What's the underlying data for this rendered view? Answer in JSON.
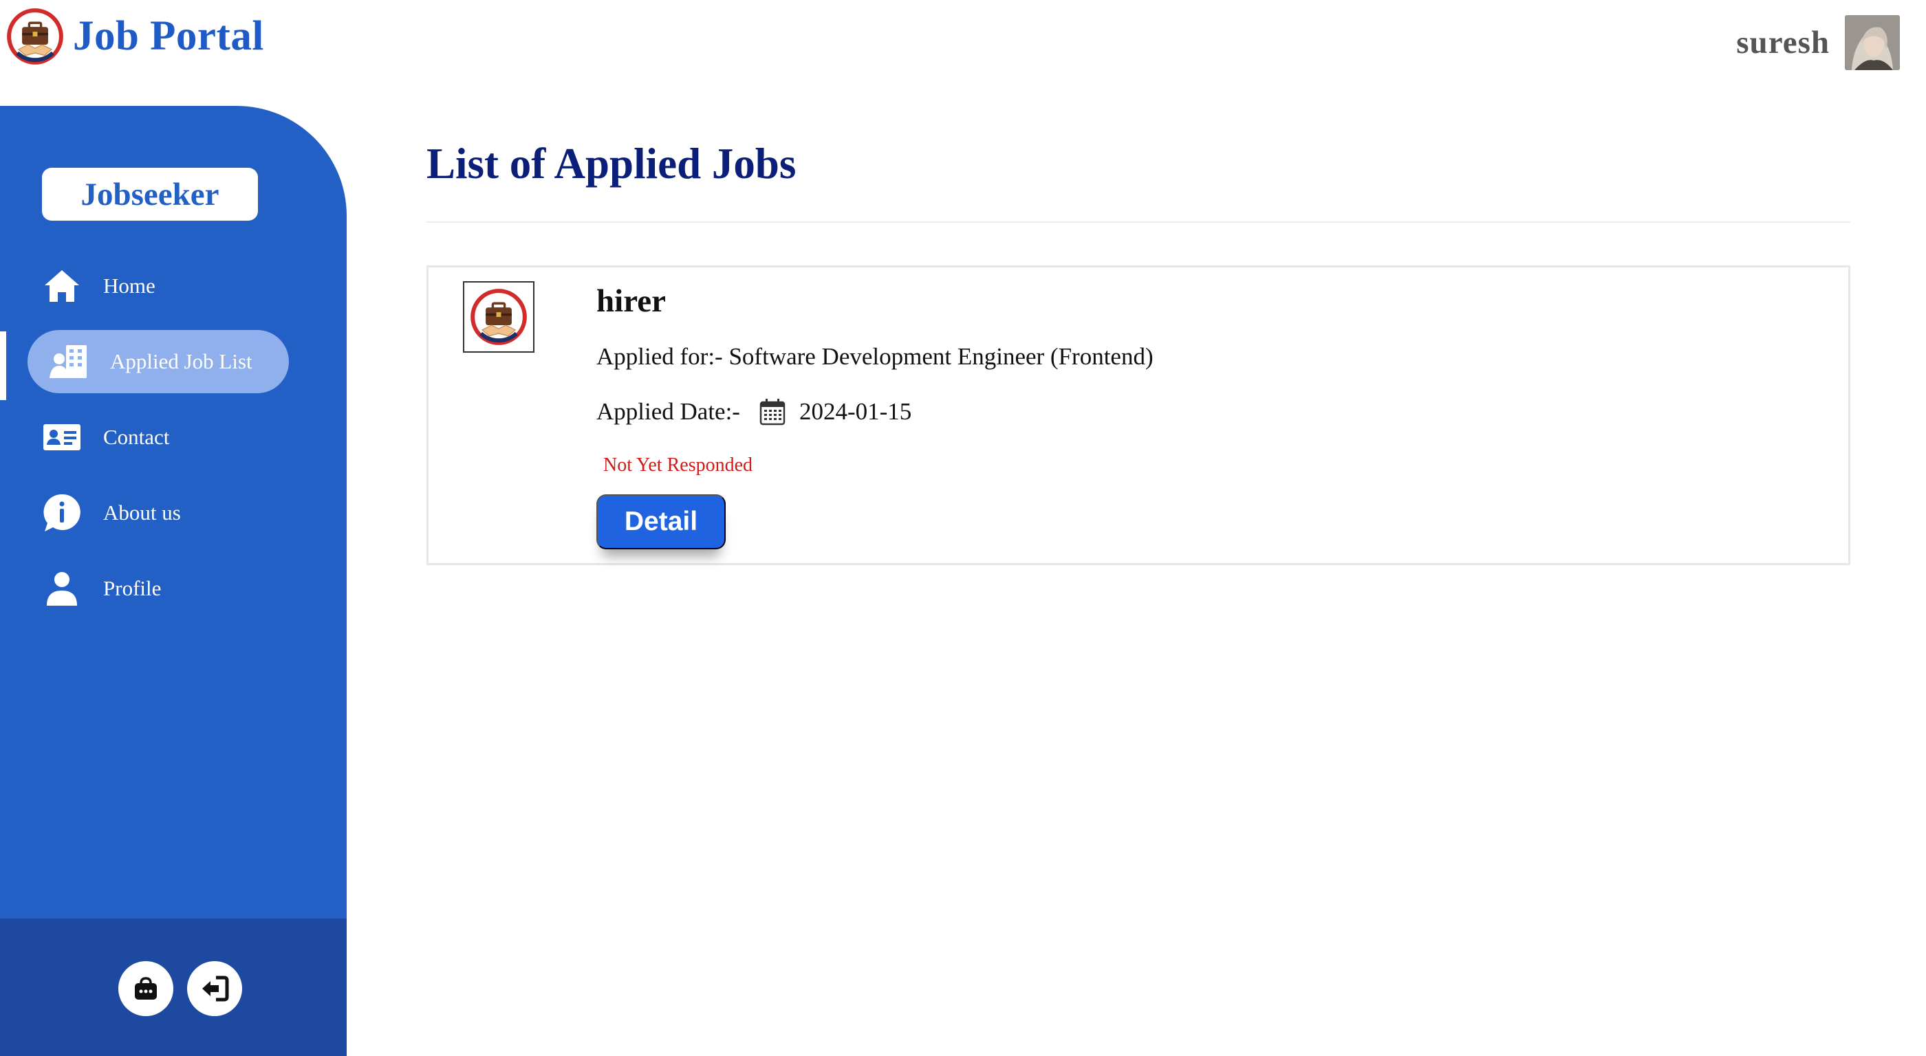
{
  "header": {
    "brand_title": "Job Portal",
    "user_name": "suresh"
  },
  "sidebar": {
    "role_label": "Jobseeker",
    "items": [
      {
        "label": "Home",
        "icon": "home-icon",
        "active": false
      },
      {
        "label": "Applied Job List",
        "icon": "applied-list-icon",
        "active": true
      },
      {
        "label": "Contact",
        "icon": "contact-card-icon",
        "active": false
      },
      {
        "label": "About us",
        "icon": "info-icon",
        "active": false
      },
      {
        "label": "Profile",
        "icon": "user-icon",
        "active": false
      }
    ],
    "footer_buttons": [
      {
        "icon": "jobs-bag-icon"
      },
      {
        "icon": "logout-icon"
      }
    ]
  },
  "main": {
    "title": "List of Applied Jobs",
    "applications": [
      {
        "company": "hirer",
        "applied_for": "Applied for:- Software Development Engineer (Frontend)",
        "applied_date_label": "Applied Date:-",
        "applied_date": "2024-01-15",
        "status": "Not Yet Responded",
        "detail_label": "Detail"
      }
    ]
  },
  "colors": {
    "brand": "#1e5bc6",
    "sidebar": "#2260c6",
    "sidebar_footer": "#1d4aa0",
    "active_pill": "#8fb0ec",
    "title": "#0b1f78",
    "status": "#d11a1a",
    "button": "#1f63e0"
  }
}
